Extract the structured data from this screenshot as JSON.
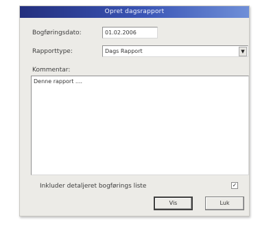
{
  "window": {
    "title": "Opret dagsrapport"
  },
  "form": {
    "date_label": "Bogføringsdato:",
    "date_value": "01.02.2006",
    "type_label": "Rapporttype:",
    "type_value": "Dags Rapport",
    "dropdown_arrow": "▼",
    "comments_label": "Kommentar:",
    "comments_value": "Denne rapport ....",
    "include_label": "Inkluder detaljeret bogførings liste",
    "include_checked": true,
    "check_mark": "✓"
  },
  "buttons": {
    "show_label": "Vis",
    "close_label": "Luk"
  }
}
